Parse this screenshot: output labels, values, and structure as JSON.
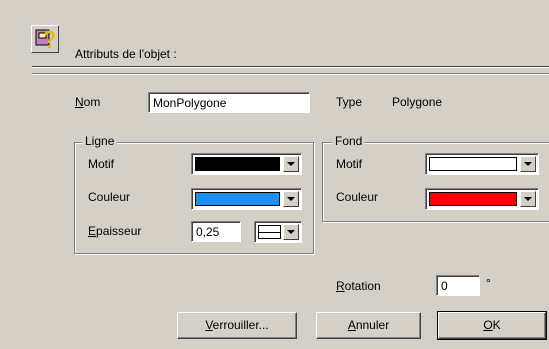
{
  "header": {
    "icon": "object-attributes-icon",
    "title": "Attributs de l'objet :"
  },
  "name_row": {
    "label": "Nom",
    "value": "MonPolygone",
    "type_label": "Type",
    "type_value": "Polygone"
  },
  "ligne": {
    "title": "Ligne",
    "motif_label": "Motif",
    "motif_color": "#000000",
    "couleur_label": "Couleur",
    "couleur_color": "#1e90f5",
    "epaisseur_label": "Epaisseur",
    "epaisseur_value": "0,25",
    "line_style_icon": "line-style-icon"
  },
  "fond": {
    "title": "Fond",
    "motif_label": "Motif",
    "motif_color": "#ffffff",
    "couleur_label": "Couleur",
    "couleur_color": "#ff0000"
  },
  "rotation": {
    "label": "Rotation",
    "value": "0",
    "unit": "°"
  },
  "buttons": {
    "lock": "Verrouiller...",
    "cancel": "Annuler",
    "ok": "OK"
  }
}
